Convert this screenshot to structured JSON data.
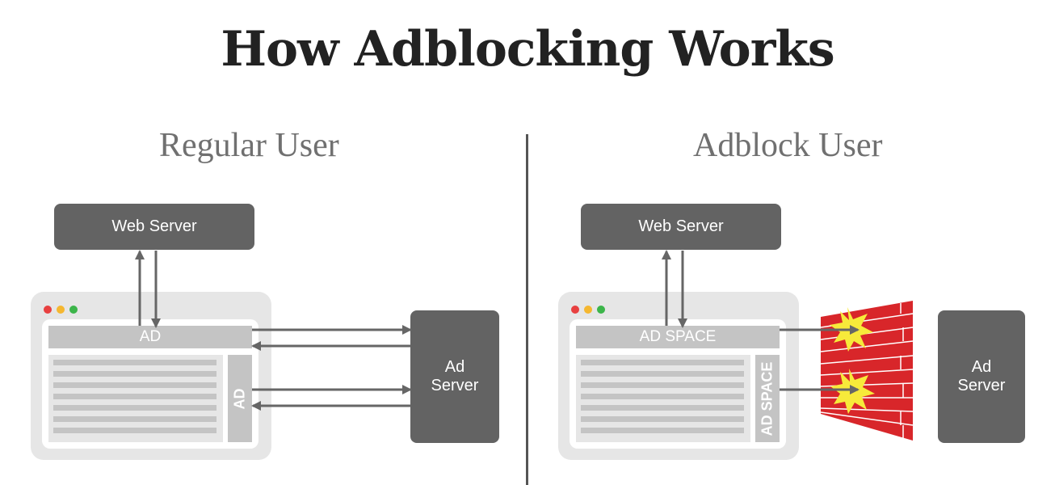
{
  "title": "How Adblocking Works",
  "panels": {
    "regular": {
      "heading": "Regular User",
      "web_server": "Web Server",
      "ad_server": [
        "Ad",
        "Server"
      ],
      "top_ad": "AD",
      "side_ad": "AD"
    },
    "adblock": {
      "heading": "Adblock User",
      "web_server": "Web Server",
      "ad_server": [
        "Ad",
        "Server"
      ],
      "top_ad": "AD SPACE",
      "side_ad": "AD SPACE"
    }
  },
  "colors": {
    "server": "#636363",
    "ad_placeholder": "#c4c4c4",
    "browser_frame": "#e6e6e6",
    "window_dots": [
      "#e84040",
      "#f5b730",
      "#3cb54a"
    ],
    "wall": "#d8262a",
    "burst": "#f7ea3a",
    "arrow": "#666666"
  }
}
